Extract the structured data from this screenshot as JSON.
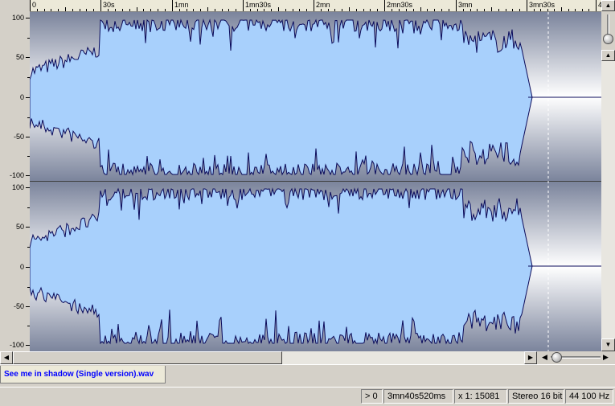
{
  "ruler": {
    "labels": [
      "0",
      "30s",
      "1mn",
      "1mn30s",
      "2mn",
      "2mn30s",
      "3mn",
      "3mn30s",
      "4"
    ]
  },
  "axis": {
    "labels": [
      "100",
      "50",
      "0",
      "-50",
      "-100"
    ]
  },
  "tab": {
    "filename": "See me in shadow (Single version).wav"
  },
  "status": {
    "position": "> 0",
    "duration": "3mn40s520ms",
    "zoom": "x 1: 15081",
    "format": "Stereo 16 bit",
    "rate": "44 100 Hz"
  },
  "colors": {
    "wave_fill": "#a8d0fc",
    "wave_line": "#0a0a5a",
    "bg_edge": "#7b849c",
    "bg_center": "#ffffff"
  }
}
